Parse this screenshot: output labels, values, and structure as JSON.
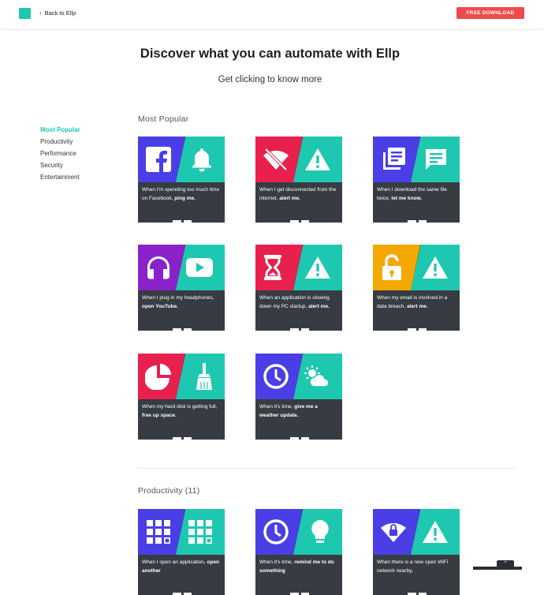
{
  "header": {
    "back_label": "Back to Ellp",
    "download_label": "FREE DOWNLOAD"
  },
  "hero": {
    "title": "Discover what you can automate with Ellp",
    "subtitle": "Get clicking to know more"
  },
  "sidebar": {
    "items": [
      {
        "label": "Most Popular",
        "active": true
      },
      {
        "label": "Productivity"
      },
      {
        "label": "Performance"
      },
      {
        "label": "Security"
      },
      {
        "label": "Entertainment"
      }
    ]
  },
  "sections": [
    {
      "title": "Most Popular",
      "cards": [
        {
          "left_icon": "facebook-icon",
          "right_icon": "bell-icon",
          "left_color": "#4a3ee6",
          "text_pre": "When I'm spending too much time on Facebook, ",
          "text_bold": "ping me."
        },
        {
          "left_icon": "wifi-off-icon",
          "right_icon": "warning-icon",
          "left_color": "#e8204e",
          "text_pre": "When I get disconnected from the internet, ",
          "text_bold": "alert me."
        },
        {
          "left_icon": "files-icon",
          "right_icon": "message-icon",
          "left_color": "#4a3ee6",
          "text_pre": "When I download the same file twice, ",
          "text_bold": "let me know."
        },
        {
          "left_icon": "headphones-icon",
          "right_icon": "youtube-icon",
          "left_color": "#8a22c9",
          "text_pre": "When I plug in my headphones, ",
          "text_bold": "open YouTube."
        },
        {
          "left_icon": "hourglass-icon",
          "right_icon": "warning-icon",
          "left_color": "#e8204e",
          "text_pre": "When an application is slowing down my PC startup, ",
          "text_bold": "alert me."
        },
        {
          "left_icon": "unlock-icon",
          "right_icon": "warning-icon",
          "left_color": "#f5a800",
          "text_pre": "When my email is involved in a data breach, ",
          "text_bold": "alert me."
        },
        {
          "left_icon": "pie-chart-icon",
          "right_icon": "broom-icon",
          "left_color": "#e8204e",
          "text_pre": "When my hard disk is getting full, ",
          "text_bold": "free up space."
        },
        {
          "left_icon": "clock-icon",
          "right_icon": "weather-icon",
          "left_color": "#4a3ee6",
          "text_pre": "When it's time, ",
          "text_bold": "give me a weather update."
        }
      ]
    },
    {
      "title": "Productivity (11)",
      "cards": [
        {
          "left_icon": "apps-grid-icon",
          "right_icon": "apps-grid-icon",
          "left_color": "#4a3ee6",
          "text_pre": "When I open an application, ",
          "text_bold": "open another"
        },
        {
          "left_icon": "clock-icon",
          "right_icon": "lightbulb-icon",
          "left_color": "#4a3ee6",
          "text_pre": "When it's time, ",
          "text_bold": "remind me to do something"
        },
        {
          "left_icon": "wifi-lock-icon",
          "right_icon": "warning-icon",
          "left_color": "#4a3ee6",
          "text_pre": "When there is a new open WiFi network nearby, ",
          "text_bold": ""
        }
      ]
    }
  ]
}
